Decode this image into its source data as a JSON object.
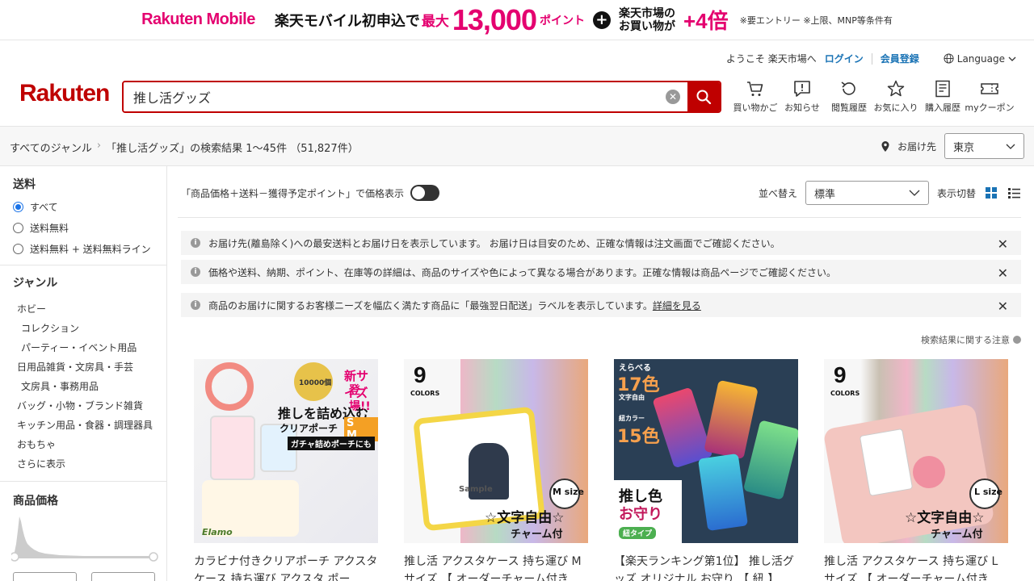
{
  "banner": {
    "brand": "Rakuten Mobile",
    "text1": "楽天モバイル初申込で",
    "max": "最大",
    "points": "13,000",
    "points_unit": "ポイント",
    "plus": "+",
    "market_line1": "楽天市場の",
    "market_line2": "お買い物が",
    "times": "+4倍",
    "note": "※要エントリー ※上限、MNP等条件有"
  },
  "header": {
    "welcome": "ようこそ 楽天市場へ",
    "login": "ログイン",
    "register": "会員登録",
    "language": "Language",
    "logo": "Rakuten",
    "search_value": "推し活グッズ",
    "icons": [
      {
        "name": "cart-icon",
        "label": "買い物かご"
      },
      {
        "name": "notification-icon",
        "label": "お知らせ"
      },
      {
        "name": "history-icon",
        "label": "閲覧履歴"
      },
      {
        "name": "star-icon",
        "label": "お気に入り"
      },
      {
        "name": "receipt-icon",
        "label": "購入履歴"
      },
      {
        "name": "coupon-icon",
        "label": "myクーポン"
      }
    ]
  },
  "breadcrumb": {
    "root": "すべてのジャンル",
    "current": "「推し活グッズ」の検索結果 1～45件 （51,827件）",
    "delivery_label": "お届け先",
    "delivery_value": "東京"
  },
  "sidebar": {
    "shipping_title": "送料",
    "shipping_options": [
      "すべて",
      "送料無料",
      "送料無料 + 送料無料ライン"
    ],
    "shipping_selected": 0,
    "genre_title": "ジャンル",
    "genres": [
      "ホビー",
      "コレクション",
      "パーティー・イベント用品",
      "日用品雑貨・文房具・手芸",
      "文房具・事務用品",
      "バッグ・小物・ブランド雑貨",
      "キッチン用品・食器・調理器具",
      "おもちゃ"
    ],
    "more": "さらに表示",
    "price_title": "商品価格"
  },
  "toolbar": {
    "price_display": "「商品価格＋送料－獲得予定ポイント」で価格表示",
    "sort_label": "並べ替え",
    "sort_value": "標準",
    "view_label": "表示切替"
  },
  "notices": [
    "お届け先(離島除く)への最安送料とお届け日を表示しています。 お届け日は目安のため、正確な情報は注文画面でご確認ください。",
    "価格や送料、納期、ポイント、在庫等の詳細は、商品のサイズや色によって異なる場合があります。正確な情報は商品ページでご確認ください。",
    "商品のお届けに関するお客様ニーズを幅広く満たす商品に「最強翌日配送」ラベルを表示しています。"
  ],
  "notice_link": "詳細を見る",
  "legal_note": "検索結果に関する注意",
  "products": [
    {
      "title": "カラビナ付きクリアポーチ アクスタケース 持ち運び アクスタ ポー…",
      "overlay": [
        "新サイズ",
        "登場!!",
        "推しを詰め込む",
        "クリアポーチ",
        "S M",
        "ガチャ詰めポーチにも",
        "10000個",
        "Elamo"
      ]
    },
    {
      "title": "推し活 アクスタケース 持ち運び Mサイズ 【 オーダーチャーム付き …",
      "overlay": [
        "9",
        "COLORS",
        "☆文字自由☆",
        "チャーム付",
        "M size",
        "Sample"
      ]
    },
    {
      "title": "【楽天ランキング第1位】 推し活グッズ オリジナル お守り 【 紐 】 …",
      "overlay": [
        "えらべる",
        "17色",
        "文字自由",
        "紐カラー",
        "15色",
        "推し色",
        "お守り",
        "紐タイプ"
      ]
    },
    {
      "title": "推し活 アクスタケース 持ち運び Lサイズ 【 オーダーチャーム付き …",
      "overlay": [
        "9",
        "COLORS",
        "☆文字自由☆",
        "チャーム付",
        "L size"
      ]
    }
  ],
  "colors": {
    "brand_red": "#bf0000",
    "mobile_pink": "#e4006f",
    "link_blue": "#1a73b5"
  }
}
